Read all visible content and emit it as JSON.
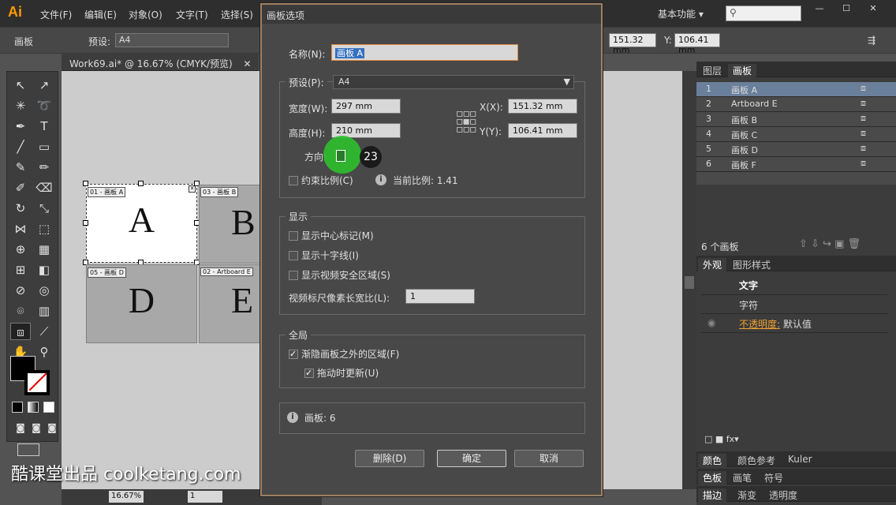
{
  "app": {
    "logo": "Ai",
    "workspace": "基本功能 ▾"
  },
  "menu": [
    "文件(F)",
    "编辑(E)",
    "对象(O)",
    "文字(T)",
    "选择(S)"
  ],
  "control": {
    "label": "画板",
    "preset_label": "预设:",
    "preset_value": "A4",
    "x_value": "151.32 mm",
    "y_label": "Y:",
    "y_value": "106.41 mm"
  },
  "document": {
    "tab_title": "Work69.ai* @ 16.67% (CMYK/预览)",
    "close": "✕"
  },
  "artboards": {
    "a": {
      "label": "01 - 画板 A",
      "letter": "A"
    },
    "b": {
      "label": "03 - 画板 B",
      "letter": "B"
    },
    "d": {
      "label": "05 - 画板 D",
      "letter": "D"
    },
    "e": {
      "label": "02 - Artboard E",
      "letter": "E"
    }
  },
  "right_panel": {
    "tabs": [
      "图层",
      "画板"
    ],
    "rows": [
      {
        "num": "1",
        "name": "画板 A"
      },
      {
        "num": "2",
        "name": "Artboard E"
      },
      {
        "num": "3",
        "name": "画板 B"
      },
      {
        "num": "4",
        "name": "画板 C"
      },
      {
        "num": "5",
        "name": "画板 D"
      },
      {
        "num": "6",
        "name": "画板 F"
      }
    ],
    "count": "6 个画板",
    "appearance_tabs": [
      "外观",
      "图形样式"
    ],
    "appearance_items": [
      "文字",
      "字符",
      "不透明度:",
      "默认值"
    ],
    "bottom_tabs_1": [
      "颜色",
      "颜色参考",
      "Kuler"
    ],
    "bottom_tabs_2": [
      "色板",
      "画笔",
      "符号"
    ],
    "bottom_tabs_3": [
      "描边",
      "渐变",
      "透明度"
    ]
  },
  "dialog": {
    "title": "画板选项",
    "name_label": "名称(N):",
    "name_value": "画板 A",
    "preset_label": "预设(P):",
    "preset_value": "A4",
    "width_label": "宽度(W):",
    "width_value": "297 mm",
    "height_label": "高度(H):",
    "height_value": "210 mm",
    "x_label": "X(X):",
    "x_value": "151.32 mm",
    "y_label": "Y(Y):",
    "y_value": "106.41 mm",
    "orientation_label": "方向:",
    "badge": "23",
    "constrain_label": "约束比例(C)",
    "ratio_label": "当前比例: 1.41",
    "display_title": "显示",
    "show_center": "显示中心标记(M)",
    "show_cross": "显示十字线(I)",
    "show_video": "显示视频安全区域(S)",
    "video_ratio_label": "视频标尺像素长宽比(L):",
    "video_ratio_value": "1",
    "global_title": "全局",
    "fade_label": "渐隐画板之外的区域(F)",
    "update_label": "拖动时更新(U)",
    "info_label": "画板: 6",
    "delete_btn": "删除(D)",
    "ok_btn": "确定",
    "cancel_btn": "取消"
  },
  "status": {
    "zoom": "16.67%",
    "page": "1"
  },
  "watermark": "酷课堂出品 coolketang.com"
}
